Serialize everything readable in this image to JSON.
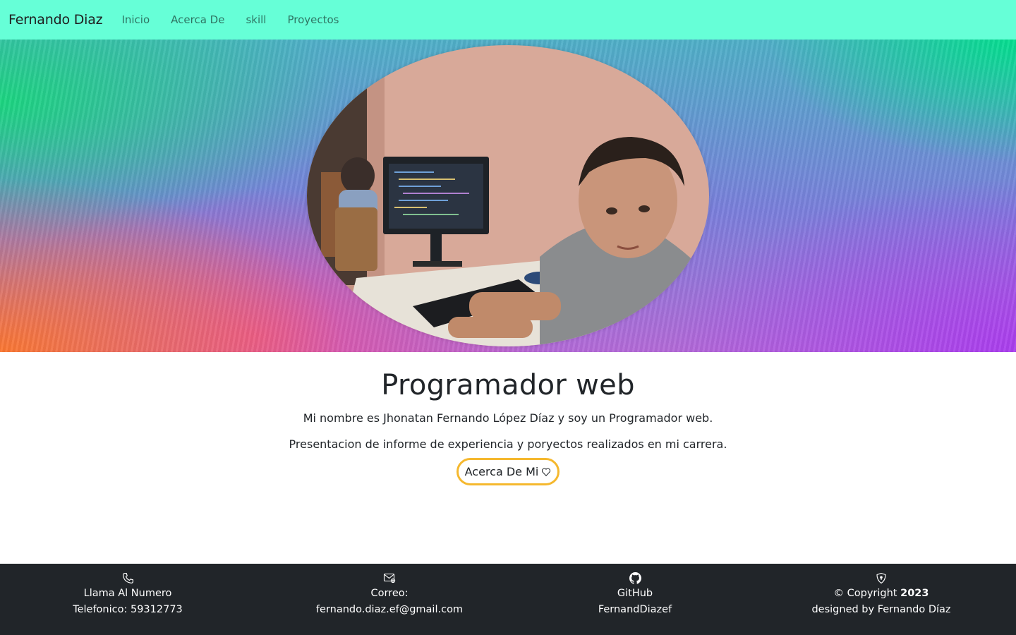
{
  "navbar": {
    "brand": "Fernando Diaz",
    "links": [
      {
        "label": "Inicio"
      },
      {
        "label": "Acerca De"
      },
      {
        "label": "skill"
      },
      {
        "label": "Proyectos"
      }
    ],
    "background": "#66ffd7"
  },
  "hero": {
    "photo_alt": "profile-photo",
    "colors": [
      "#00e08c",
      "#7b7fdc",
      "#b46ad8",
      "#ff7828"
    ]
  },
  "main": {
    "title": "Programador web",
    "intro": "Mi nombre es Jhonatan Fernando López Díaz y soy un Programador web.",
    "description": "Presentacion de informe de experiencia y poryectos realizados en mi carrera.",
    "about_button": {
      "label": "Acerca De Mi",
      "icon": "heart-icon",
      "border_color": "#f5b82e"
    }
  },
  "footer": {
    "background": "#212529",
    "phone": {
      "icon": "phone-icon",
      "line1": "Llama Al Numero",
      "line2": "Telefonico: 59312773"
    },
    "email": {
      "icon": "envelope-icon",
      "line1": "Correo:",
      "line2": "fernando.diaz.ef@gmail.com"
    },
    "github": {
      "icon": "github-icon",
      "line1": "GitHub",
      "line2": "FernandDiazef"
    },
    "copyright": {
      "icon": "shield-icon",
      "symbol": "©",
      "text": " Copyright ",
      "year": "2023",
      "line2": "designed by Fernando Díaz"
    }
  }
}
